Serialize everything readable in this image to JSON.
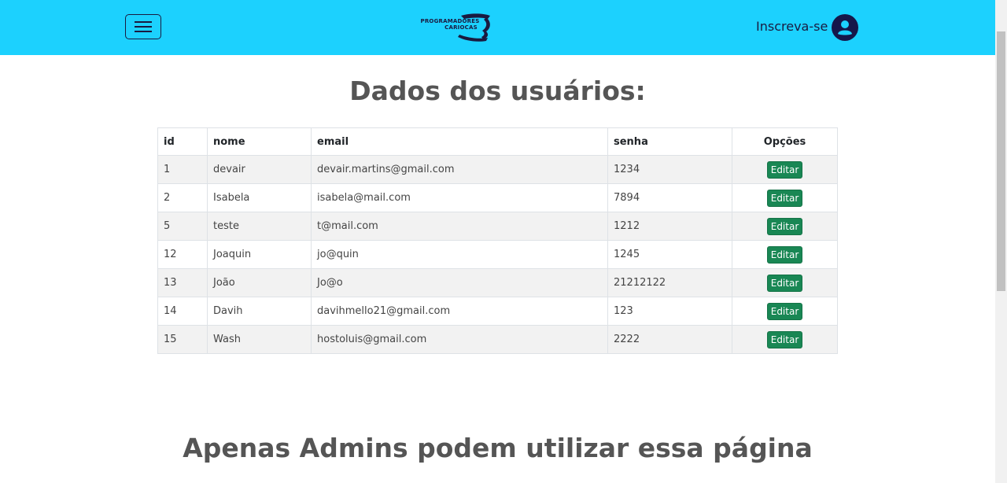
{
  "navbar": {
    "logo_line1": "PROGRAMADORES",
    "logo_line2": "CARIOCAS",
    "signup_label": "Inscreva-se",
    "background": "#1cd1fe",
    "menu_icon": "hamburger-icon",
    "user_icon": "user-circle-icon"
  },
  "main": {
    "title": "Dados dos usuários:",
    "table": {
      "headers": [
        "id",
        "nome",
        "email",
        "senha",
        "Opções"
      ],
      "rows": [
        {
          "id": "1",
          "nome": "devair",
          "email": "devair.martins@gmail.com",
          "senha": "1234",
          "action": "Editar"
        },
        {
          "id": "2",
          "nome": "Isabela",
          "email": "isabela@mail.com",
          "senha": "7894",
          "action": "Editar"
        },
        {
          "id": "5",
          "nome": "teste",
          "email": "t@mail.com",
          "senha": "1212",
          "action": "Editar"
        },
        {
          "id": "12",
          "nome": "Joaquin",
          "email": "jo@quin",
          "senha": "1245",
          "action": "Editar"
        },
        {
          "id": "13",
          "nome": "João",
          "email": "Jo@o",
          "senha": "21212122",
          "action": "Editar"
        },
        {
          "id": "14",
          "nome": "Davih",
          "email": "davihmello21@gmail.com",
          "senha": "123",
          "action": "Editar"
        },
        {
          "id": "15",
          "nome": "Wash",
          "email": "hostoluis@gmail.com",
          "senha": "2222",
          "action": "Editar"
        }
      ]
    },
    "edit_button_color": "#198754"
  },
  "footer": {
    "notice": "Apenas Admins podem utilizar essa página"
  }
}
